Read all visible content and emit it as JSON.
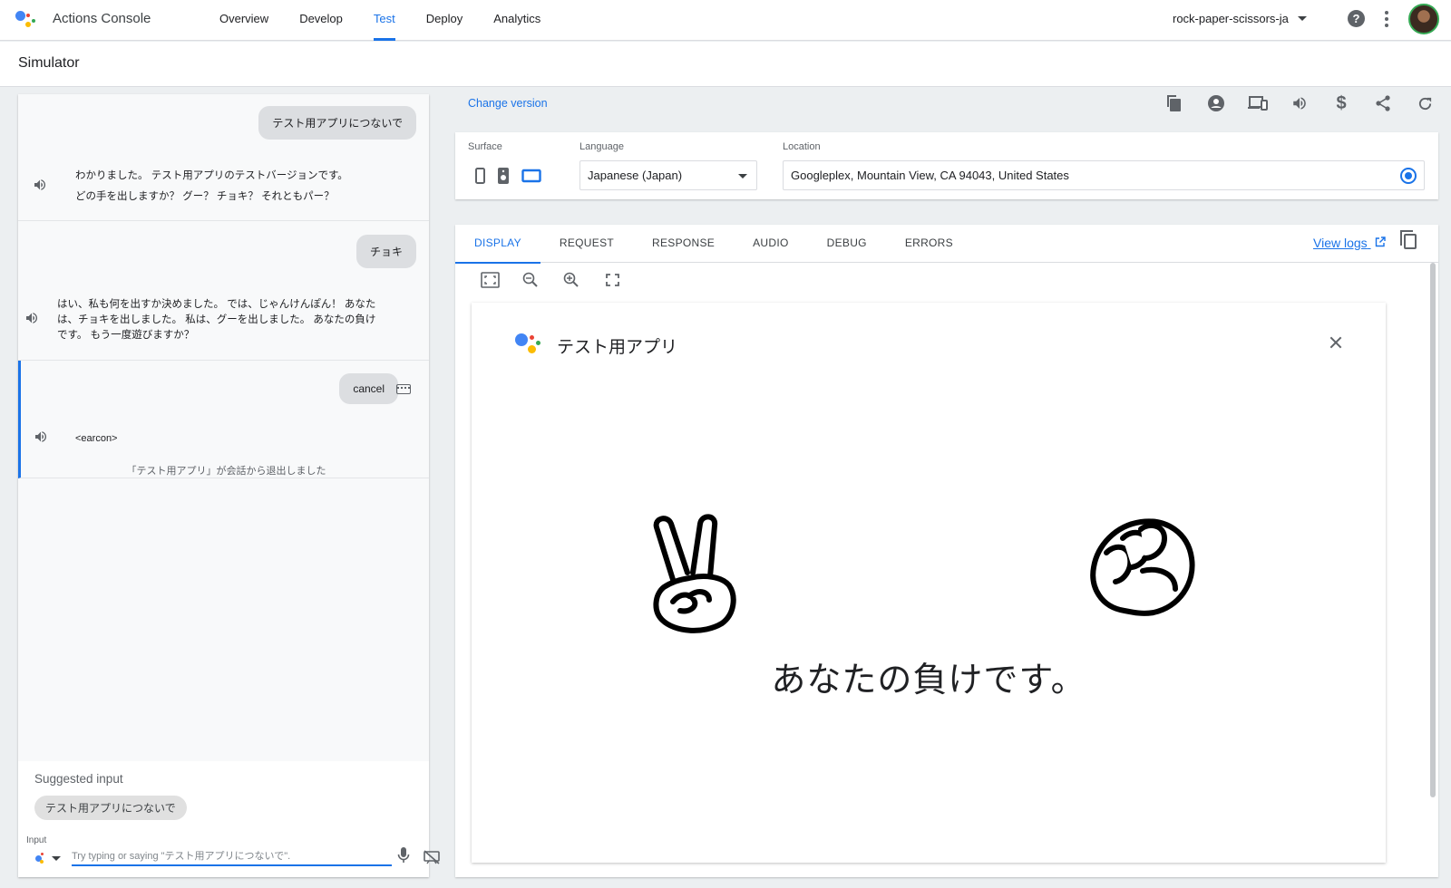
{
  "topbar": {
    "app_title": "Actions Console",
    "nav": [
      "Overview",
      "Develop",
      "Test",
      "Deploy",
      "Analytics"
    ],
    "active_nav": "Test",
    "project": "rock-paper-scissors-ja",
    "help": "?"
  },
  "subbar": {
    "title": "Simulator"
  },
  "chat": {
    "turns": [
      {
        "user": "テスト用アプリにつないで",
        "response_lines": [
          "わかりました。 テスト用アプリのテストバージョンです。",
          "どの手を出しますか？ グー？ チョキ？ それともパー？"
        ]
      },
      {
        "user": "チョキ",
        "response_lines": [
          "はい、私も何を出すか決めました。 では、じゃんけんぽん！ あなた",
          "は、チョキを出しました。 私は、グーを出しました。 あなたの負け",
          "です。 もう一度遊びますか？"
        ]
      },
      {
        "user": "cancel",
        "response_lines": [
          "<earcon>"
        ],
        "note": "「テスト用アプリ」が会話から退出しました"
      }
    ],
    "suggested_label": "Suggested input",
    "suggested_chip": "テスト用アプリにつないで",
    "input_label": "Input",
    "input_placeholder": "Try typing or saying \"テスト用アプリにつないで\"."
  },
  "toolbar": {
    "change_version": "Change version",
    "icons": [
      "copy-icon",
      "account-icon",
      "devices-icon",
      "volume-icon",
      "dollar-icon",
      "share-icon",
      "refresh-icon"
    ]
  },
  "settings": {
    "surface_label": "Surface",
    "language_label": "Language",
    "language_value": "Japanese (Japan)",
    "location_label": "Location",
    "location_value": "Googleplex, Mountain View, CA 94043, United States"
  },
  "panel": {
    "tabs": [
      "DISPLAY",
      "REQUEST",
      "RESPONSE",
      "AUDIO",
      "DEBUG",
      "ERRORS"
    ],
    "active_tab": "DISPLAY",
    "view_logs": "View logs",
    "card_title": "テスト用アプリ",
    "result_text": "あなたの負けです。",
    "user_hand": "scissors",
    "assistant_hand": "rock"
  },
  "colors": {
    "accent": "#1a73e8",
    "google_blue": "#4285f4",
    "google_red": "#ea4335",
    "google_yellow": "#fbbc04",
    "google_green": "#34a853"
  }
}
